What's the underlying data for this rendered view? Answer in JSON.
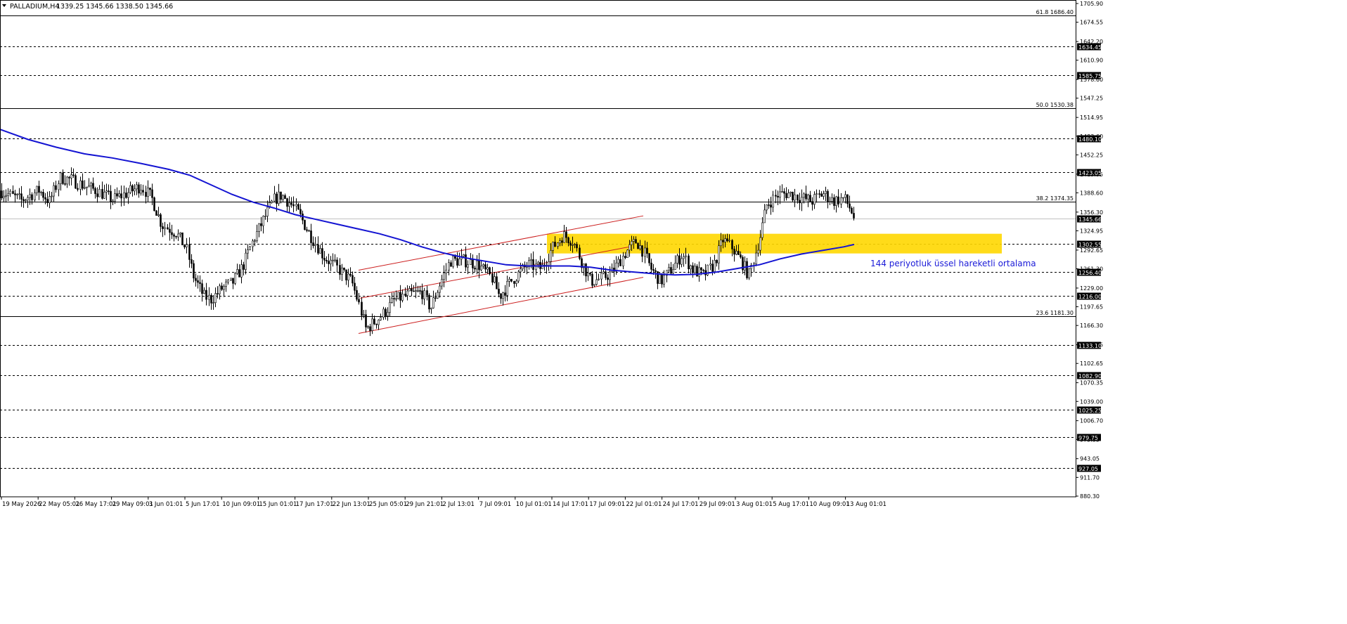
{
  "window": {
    "title": "PALLADIUM,H4",
    "ohlc": "1339.25 1345.66 1338.50 1345.66",
    "menu_icon": "triangle-down-icon"
  },
  "colors": {
    "background": "#ffffff",
    "text": "#000000",
    "ema": "#1414d2",
    "channel": "#cc1f1f",
    "zone": "#ffd700",
    "label_bg": "#000000",
    "label_text": "#ffffff",
    "annotation": "#1b1bd8"
  },
  "chart_data": {
    "type": "candlestick",
    "symbol": "PALLADIUM",
    "timeframe": "H4",
    "ylim": [
      880.3,
      1705.9
    ],
    "y_ticks": [
      "1705.90",
      "1674.55",
      "1642.20",
      "1610.90",
      "1578.60",
      "1547.25",
      "1514.95",
      "1483.60",
      "1452.25",
      "1419.95",
      "1388.60",
      "1356.30",
      "1324.95",
      "1292.65",
      "1261.30",
      "1229.00",
      "1197.65",
      "1166.30",
      "1133.95",
      "1102.65",
      "1070.35",
      "1039.00",
      "1006.70",
      "975.35",
      "943.05",
      "911.70",
      "880.30"
    ],
    "x_ticks": [
      "19 May 2026",
      "22 May 05:01",
      "26 May 17:01",
      "29 May 09:01",
      "3 Jun 01:01",
      "5 Jun 17:01",
      "10 Jun 09:01",
      "15 Jun 01:01",
      "17 Jun 17:01",
      "22 Jun 13:01",
      "25 Jun 05:01",
      "29 Jun 21:01",
      "2 Jul 13:01",
      "7 Jul 09:01",
      "10 Jul 01:01",
      "14 Jul 17:01",
      "17 Jul 09:01",
      "22 Jul 01:01",
      "24 Jul 17:01",
      "29 Jul 09:01",
      "3 Aug 01:01",
      "5 Aug 17:01",
      "10 Aug 09:01",
      "13 Aug 01:01"
    ],
    "horizontal_levels": [
      {
        "value": 1634.45,
        "label": "1634.45"
      },
      {
        "value": 1585.75,
        "label": "1585.75"
      },
      {
        "value": 1480.1,
        "label": "1480.10"
      },
      {
        "value": 1423.05,
        "label": "1423.05"
      },
      {
        "value": 1302.55,
        "label": "1302.55"
      },
      {
        "value": 1256.4,
        "label": "1256.40"
      },
      {
        "value": 1216.0,
        "label": "1216.00"
      },
      {
        "value": 1133.1,
        "label": "1133.10"
      },
      {
        "value": 1082.9,
        "label": "1082.90"
      },
      {
        "value": 1025.25,
        "label": "1025.25"
      },
      {
        "value": 979.75,
        "label": "979.75"
      },
      {
        "value": 927.05,
        "label": "927.05"
      }
    ],
    "fibonacci_levels": [
      {
        "value": 1686.4,
        "label": "61.8 1686.40"
      },
      {
        "value": 1530.38,
        "label": "50.0 1530.38"
      },
      {
        "value": 1374.35,
        "label": "38.2 1374.35"
      },
      {
        "value": 1181.3,
        "label": "23.6 1181.30"
      }
    ],
    "current_price": {
      "value": 1345.66,
      "label": "1345.66"
    },
    "ema_label": "144 periyotluk üssel hareketli ortalama",
    "ema_period": 144,
    "ema_points": [
      [
        0,
        1495
      ],
      [
        40,
        1478
      ],
      [
        80,
        1465
      ],
      [
        120,
        1454
      ],
      [
        160,
        1447
      ],
      [
        200,
        1438
      ],
      [
        240,
        1428
      ],
      [
        270,
        1418
      ],
      [
        300,
        1402
      ],
      [
        330,
        1386
      ],
      [
        360,
        1373
      ],
      [
        390,
        1363
      ],
      [
        420,
        1352
      ],
      [
        450,
        1344
      ],
      [
        480,
        1336
      ],
      [
        510,
        1328
      ],
      [
        540,
        1320
      ],
      [
        570,
        1310
      ],
      [
        600,
        1298
      ],
      [
        630,
        1288
      ],
      [
        660,
        1280
      ],
      [
        690,
        1274
      ],
      [
        720,
        1268
      ],
      [
        750,
        1266
      ],
      [
        780,
        1266
      ],
      [
        810,
        1266
      ],
      [
        840,
        1264
      ],
      [
        870,
        1259
      ],
      [
        900,
        1256
      ],
      [
        930,
        1253
      ],
      [
        960,
        1251
      ],
      [
        990,
        1252
      ],
      [
        1020,
        1256
      ],
      [
        1050,
        1262
      ],
      [
        1080,
        1268
      ],
      [
        1110,
        1278
      ],
      [
        1140,
        1286
      ],
      [
        1170,
        1292
      ],
      [
        1200,
        1298
      ],
      [
        1215,
        1302
      ]
    ],
    "channel": {
      "upper": [
        [
          510,
          1259
        ],
        [
          915,
          1350
        ]
      ],
      "middle": [
        [
          512,
          1212
        ],
        [
          895,
          1298
        ]
      ],
      "lower": [
        [
          510,
          1153
        ],
        [
          915,
          1247
        ]
      ]
    },
    "zone": {
      "x0": 778,
      "x1": 1425,
      "y_top": 1320,
      "y_bottom": 1287
    },
    "price_path": [
      [
        0,
        1392
      ],
      [
        30,
        1376
      ],
      [
        55,
        1393
      ],
      [
        70,
        1374
      ],
      [
        85,
        1414
      ],
      [
        100,
        1411
      ],
      [
        120,
        1400
      ],
      [
        140,
        1391
      ],
      [
        160,
        1377
      ],
      [
        180,
        1388
      ],
      [
        200,
        1400
      ],
      [
        215,
        1381
      ],
      [
        230,
        1335
      ],
      [
        250,
        1322
      ],
      [
        265,
        1295
      ],
      [
        275,
        1248
      ],
      [
        290,
        1215
      ],
      [
        300,
        1210
      ],
      [
        315,
        1228
      ],
      [
        330,
        1238
      ],
      [
        345,
        1265
      ],
      [
        360,
        1310
      ],
      [
        375,
        1345
      ],
      [
        390,
        1378
      ],
      [
        400,
        1385
      ],
      [
        415,
        1368
      ],
      [
        425,
        1352
      ],
      [
        440,
        1320
      ],
      [
        460,
        1282
      ],
      [
        480,
        1262
      ],
      [
        500,
        1240
      ],
      [
        512,
        1195
      ],
      [
        520,
        1160
      ],
      [
        540,
        1180
      ],
      [
        560,
        1208
      ],
      [
        580,
        1218
      ],
      [
        600,
        1222
      ],
      [
        612,
        1195
      ],
      [
        625,
        1235
      ],
      [
        640,
        1275
      ],
      [
        660,
        1275
      ],
      [
        680,
        1268
      ],
      [
        700,
        1245
      ],
      [
        710,
        1215
      ],
      [
        730,
        1245
      ],
      [
        750,
        1268
      ],
      [
        770,
        1262
      ],
      [
        785,
        1295
      ],
      [
        800,
        1318
      ],
      [
        815,
        1308
      ],
      [
        825,
        1278
      ],
      [
        840,
        1240
      ],
      [
        855,
        1245
      ],
      [
        870,
        1255
      ],
      [
        890,
        1290
      ],
      [
        905,
        1308
      ],
      [
        915,
        1290
      ],
      [
        925,
        1262
      ],
      [
        940,
        1240
      ],
      [
        955,
        1262
      ],
      [
        970,
        1285
      ],
      [
        985,
        1260
      ],
      [
        1000,
        1250
      ],
      [
        1015,
        1268
      ],
      [
        1028,
        1310
      ],
      [
        1040,
        1298
      ],
      [
        1055,
        1272
      ],
      [
        1065,
        1250
      ],
      [
        1080,
        1312
      ],
      [
        1090,
        1368
      ],
      [
        1105,
        1385
      ],
      [
        1120,
        1388
      ],
      [
        1140,
        1380
      ],
      [
        1155,
        1375
      ],
      [
        1170,
        1388
      ],
      [
        1185,
        1375
      ],
      [
        1200,
        1380
      ],
      [
        1210,
        1360
      ],
      [
        1215,
        1345
      ]
    ]
  }
}
